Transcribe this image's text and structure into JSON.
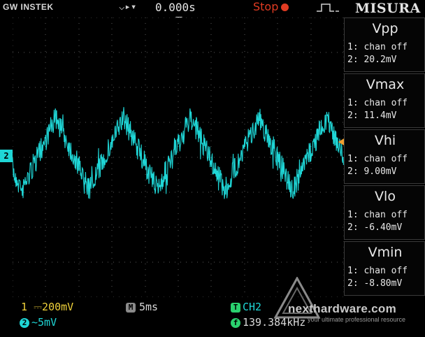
{
  "header": {
    "brand": "GW INSTEK",
    "trigger_symbol": "⌵▸▾",
    "delay": "0.000s",
    "run_state": "Stop",
    "run_state_color": "#e03b22",
    "misura": "MISURA"
  },
  "measurements": [
    {
      "name": "Vpp",
      "ch1": "1: chan off",
      "ch2": "2: 20.2mV"
    },
    {
      "name": "Vmax",
      "ch1": "1: chan off",
      "ch2": "2: 11.4mV"
    },
    {
      "name": "Vhi",
      "ch1": "1: chan off",
      "ch2": "2: 9.00mV"
    },
    {
      "name": "Vlo",
      "ch1": "1: chan off",
      "ch2": "2: -6.40mV"
    },
    {
      "name": "Vmin",
      "ch1": "1: chan off",
      "ch2": "2: -8.80mV"
    }
  ],
  "footer": {
    "ch1_index": "1",
    "ch1_scale": "200mV",
    "ch1_coupling": "⎓",
    "ch2_index": "2",
    "ch2_coupling": "~",
    "ch2_scale": "5mV",
    "timebase_badge": "M",
    "timebase": "5ms",
    "trigger_badge": "T",
    "trigger_source": "CH2",
    "freq_badge": "f",
    "frequency": "139.384kHz"
  },
  "ch2_marker": "2",
  "waveform": {
    "color": "#1fd6d6",
    "grid_color": "#5a5a5a",
    "periods_visible": 5
  },
  "watermark": {
    "text": "nexthardware.com",
    "subtitle": "your ultimate professional resource"
  }
}
